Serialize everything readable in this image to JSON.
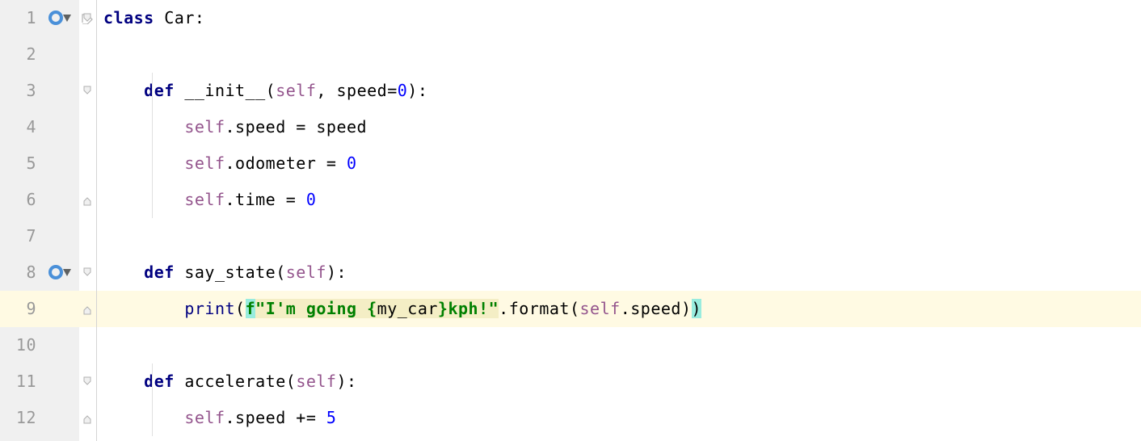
{
  "lines": {
    "n1": "1",
    "n2": "2",
    "n3": "3",
    "n4": "4",
    "n5": "5",
    "n6": "6",
    "n7": "7",
    "n8": "8",
    "n9": "9",
    "n10": "10",
    "n11": "11",
    "n12": "12"
  },
  "code": {
    "l1": {
      "kw_class": "class ",
      "name": "Car",
      "colon": ":"
    },
    "l3": {
      "indent": "    ",
      "kw_def": "def ",
      "name": "__init__",
      "lp": "(",
      "self": "self",
      "comma": ", ",
      "arg": "speed",
      "eq": "=",
      "zero": "0",
      "rp_colon": "):"
    },
    "l4": {
      "indent": "        ",
      "self": "self",
      "dot": ".",
      "attr": "speed ",
      "eq": "= ",
      "rhs": "speed"
    },
    "l5": {
      "indent": "        ",
      "self": "self",
      "dot": ".",
      "attr": "odometer ",
      "eq": "= ",
      "zero": "0"
    },
    "l6": {
      "indent": "        ",
      "self": "self",
      "dot": ".",
      "attr": "time ",
      "eq": "= ",
      "zero": "0"
    },
    "l8": {
      "indent": "    ",
      "kw_def": "def ",
      "name": "say_state",
      "lp": "(",
      "self": "self",
      "rp_colon": "):"
    },
    "l9": {
      "indent": "        ",
      "print": "print",
      "lp": "(",
      "f": "f",
      "q1": "\"",
      "s1": "I'm going ",
      "lb": "{",
      "var": "my_car",
      "rb": "}",
      "s2": "kph!",
      "q2": "\"",
      "dot": ".",
      "fmt": "format",
      "lp2": "(",
      "self": "self",
      "dot2": ".",
      "speed": "speed",
      "rp2": ")",
      "rp": ")"
    },
    "l11": {
      "indent": "    ",
      "kw_def": "def ",
      "name": "accelerate",
      "lp": "(",
      "self": "self",
      "rp_colon": "):"
    },
    "l12": {
      "indent": "        ",
      "self": "self",
      "dot": ".",
      "attr": "speed ",
      "op": "+= ",
      "five": "5"
    }
  }
}
